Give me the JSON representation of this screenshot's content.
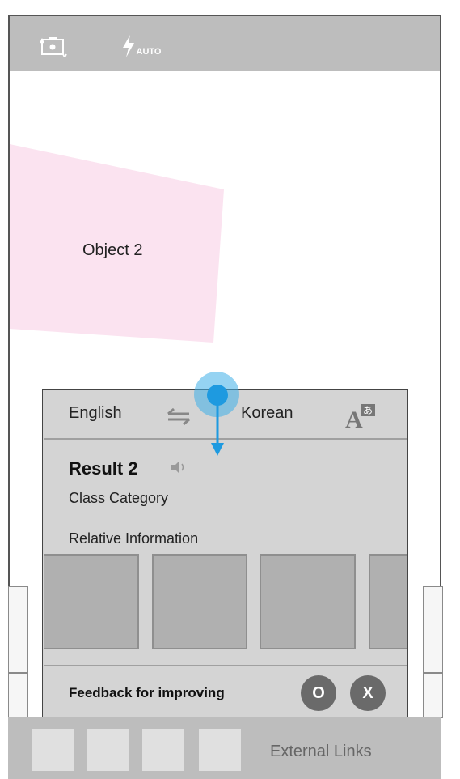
{
  "camera": {
    "switch_icon": "camera-switch-icon",
    "flash_icon": "flash-auto-icon",
    "flash_label": "AUTO"
  },
  "object": {
    "label": "Object 2",
    "color": "#fbe3f0"
  },
  "card": {
    "source_lang": "English",
    "target_lang": "Korean",
    "swap_icon": "swap-arrows-icon",
    "translate_icon": "translate-icon",
    "translate_glyph": "あ",
    "result_title": "Result 2",
    "speaker_icon": "speaker-icon",
    "class_category": "Class Category",
    "relative_info": "Relative Information",
    "feedback_label": "Feedback for improving",
    "ok_label": "O",
    "no_label": "X"
  },
  "bottom": {
    "external_links": "External Links"
  },
  "colors": {
    "accent": "#1e9ae0",
    "bar": "#bdbdbd",
    "card": "#d4d4d4"
  }
}
